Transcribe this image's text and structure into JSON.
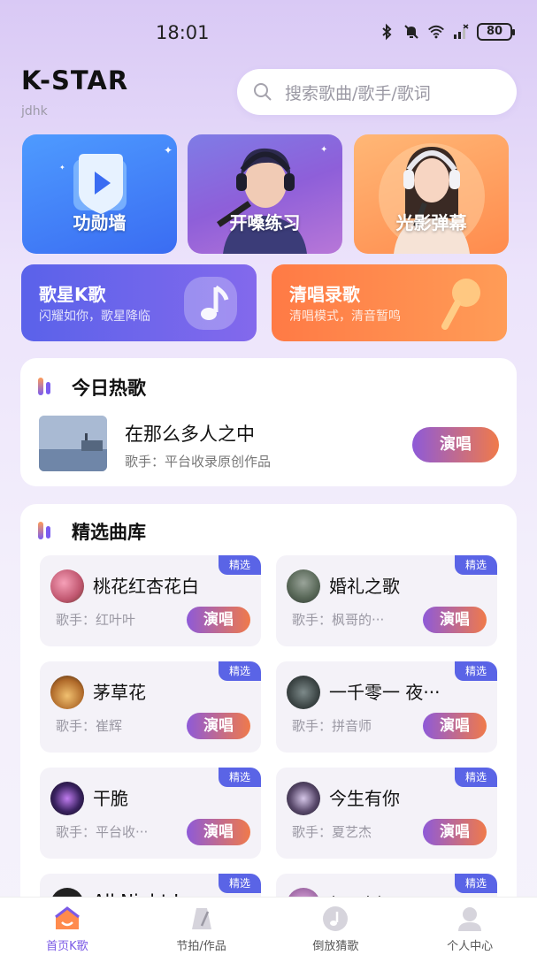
{
  "status_bar": {
    "time": "18:01",
    "battery": "80",
    "wifi_label": "6"
  },
  "header": {
    "title": "K-STAR",
    "subtitle": "jdhk",
    "search_placeholder": "搜索歌曲/歌手/歌词"
  },
  "tiles": [
    {
      "label": "功勋墙"
    },
    {
      "label": "开嗓练习"
    },
    {
      "label": "光影弹幕"
    }
  ],
  "wide_cards": [
    {
      "title": "歌星K歌",
      "subtitle": "闪耀如你，歌星降临"
    },
    {
      "title": "清唱录歌",
      "subtitle": "清唱模式，清音暂鸣"
    }
  ],
  "hot_today": {
    "title": "今日热歌",
    "song": "在那么多人之中",
    "singer": "歌手：平台收录原创作品",
    "button": "演唱"
  },
  "library": {
    "title": "精选曲库",
    "badge": "精选",
    "button": "演唱",
    "items": [
      {
        "title": "桃花红杏花白",
        "singer": "歌手：红叶叶"
      },
      {
        "title": "婚礼之歌",
        "singer": "歌手：枫哥的···"
      },
      {
        "title": "茅草花",
        "singer": "歌手：崔辉"
      },
      {
        "title": "一千零一 夜···",
        "singer": "歌手：拼音师"
      },
      {
        "title": "干脆",
        "singer": "歌手：平台收···"
      },
      {
        "title": "今生有你",
        "singer": "歌手：夏艺杰"
      },
      {
        "title": "All Night Lo",
        "singer": ""
      },
      {
        "title": "相思树",
        "singer": ""
      }
    ]
  },
  "tab_bar": [
    {
      "label": "首页K歌",
      "active": true
    },
    {
      "label": "节拍/作品",
      "active": false
    },
    {
      "label": "倒放猜歌",
      "active": false
    },
    {
      "label": "个人中心",
      "active": false
    }
  ],
  "colors": {
    "accent": "#7b5ae6",
    "orange": "#ff8b4d",
    "blue": "#3a6cf2"
  }
}
